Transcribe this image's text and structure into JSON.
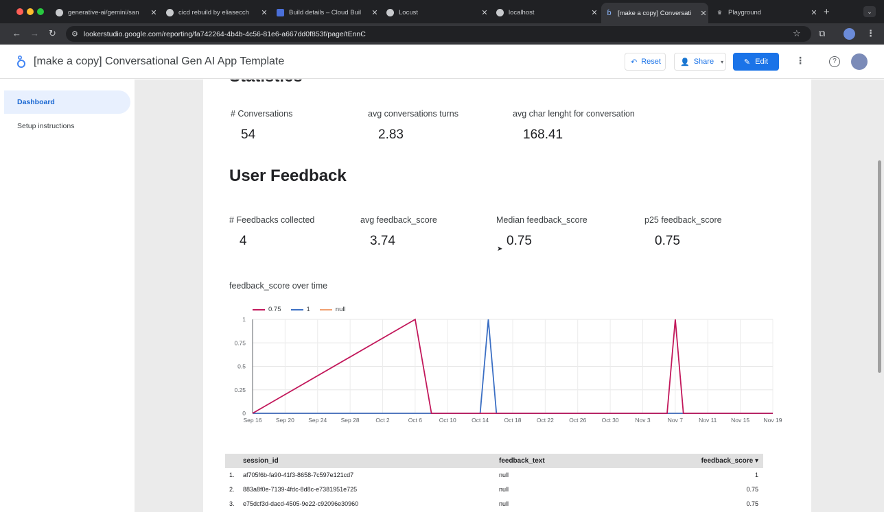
{
  "browser": {
    "tabs": [
      {
        "title": "generative-ai/gemini/san",
        "icon": "github-icon"
      },
      {
        "title": "cicd rebuild by eliasecch",
        "icon": "github-icon"
      },
      {
        "title": "Build details – Cloud Buil",
        "icon": "cloud-build-icon"
      },
      {
        "title": "Locust",
        "icon": "globe-icon"
      },
      {
        "title": "localhost",
        "icon": "globe-icon"
      },
      {
        "title": "[make a copy] Conversati",
        "icon": "looker-studio-icon",
        "active": true
      },
      {
        "title": "Playground",
        "icon": "playground-icon"
      }
    ],
    "url": "lookerstudio.google.com/reporting/fa742264-4b4b-4c56-81e6-a667dd0f853f/page/tEnnC"
  },
  "header": {
    "title": "[make a copy] Conversational Gen AI App Template",
    "reset_label": "Reset",
    "share_label": "Share",
    "edit_label": "Edit",
    "accent": "#1a73e8"
  },
  "sidebar": {
    "items": [
      {
        "label": "Dashboard",
        "active": true
      },
      {
        "label": "Setup instructions",
        "active": false
      }
    ]
  },
  "statistics": {
    "heading": "Statistics",
    "kpis": [
      {
        "label": "# Conversations",
        "value": "54"
      },
      {
        "label": "avg conversations turns",
        "value": "2.83"
      },
      {
        "label": "avg char lenght for conversation",
        "value": "168.41"
      }
    ]
  },
  "feedback": {
    "heading": "User Feedback",
    "kpis": [
      {
        "label": "# Feedbacks collected",
        "value": "4"
      },
      {
        "label": "avg feedback_score",
        "value": "3.74"
      },
      {
        "label": "Median feedback_score",
        "value": "0.75"
      },
      {
        "label": "p25 feedback_score",
        "value": "0.75"
      }
    ]
  },
  "chart_data": {
    "type": "line",
    "title": "feedback_score over time",
    "x_tick_labels": [
      "Sep 16",
      "Sep 20",
      "Sep 24",
      "Sep 28",
      "Oct 2",
      "Oct 6",
      "Oct 10",
      "Oct 14",
      "Oct 18",
      "Oct 22",
      "Oct 26",
      "Oct 30",
      "Nov 3",
      "Nov 7",
      "Nov 11",
      "Nov 15",
      "Nov 19"
    ],
    "y_tick_labels": [
      "0",
      "0.25",
      "0.5",
      "0.75",
      "1"
    ],
    "ylim": [
      0,
      1
    ],
    "grid": true,
    "legend_position": "top-left",
    "series": [
      {
        "name": "0.75",
        "color": "#c2185b",
        "points": [
          [
            "Sep 16",
            0
          ],
          [
            "Oct 6",
            1
          ],
          [
            "Oct 8",
            0
          ],
          [
            "Nov 6",
            0
          ],
          [
            "Nov 7",
            1
          ],
          [
            "Nov 8",
            0
          ],
          [
            "Nov 19",
            0
          ]
        ]
      },
      {
        "name": "1",
        "color": "#3b6fc4",
        "points": [
          [
            "Sep 16",
            0
          ],
          [
            "Oct 14",
            0
          ],
          [
            "Oct 15",
            1
          ],
          [
            "Oct 16",
            0
          ],
          [
            "Nov 19",
            0
          ]
        ]
      },
      {
        "name": "null",
        "color": "#f0a070",
        "points": [
          [
            "Sep 16",
            0
          ],
          [
            "Nov 19",
            0
          ]
        ]
      }
    ]
  },
  "table": {
    "columns": [
      "session_id",
      "feedback_text",
      "feedback_score ▾"
    ],
    "rows": [
      {
        "index": "1.",
        "session_id": "af705f6b-fa90-41f3-8658-7c597e121cd7",
        "feedback_text": "null",
        "feedback_score": "1"
      },
      {
        "index": "2.",
        "session_id": "883a8f0e-7139-4fdc-8d8c-e7381951e725",
        "feedback_text": "null",
        "feedback_score": "0.75"
      },
      {
        "index": "3.",
        "session_id": "e75dcf3d-dacd-4505-9e22-c92096e30960",
        "feedback_text": "null",
        "feedback_score": "0.75"
      }
    ]
  }
}
